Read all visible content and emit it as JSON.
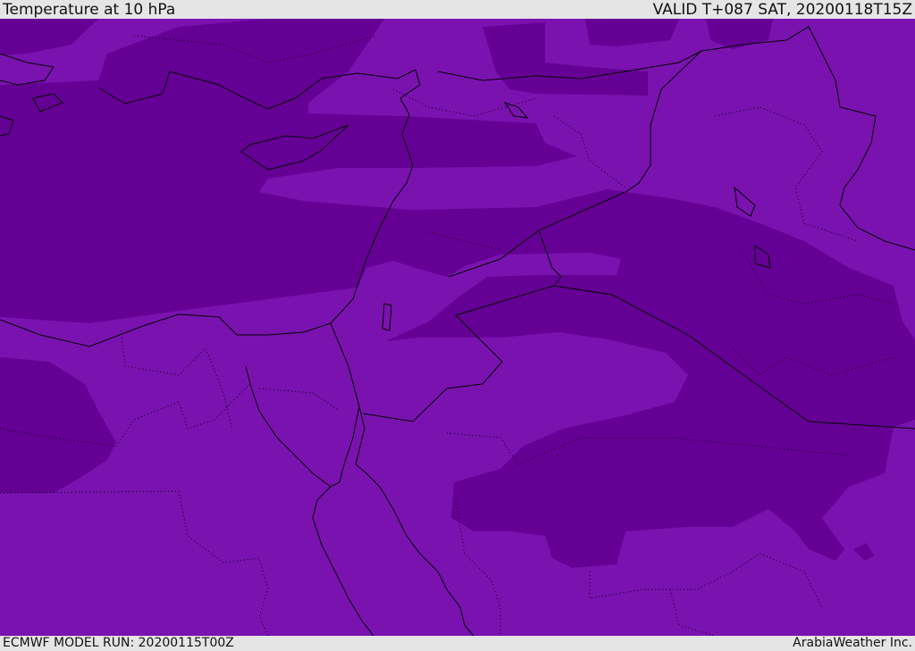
{
  "header": {
    "title": "Temperature at 10 hPa",
    "valid": "VALID T+087 SAT, 20200118T15Z"
  },
  "footer": {
    "model_run": "ECMWF MODEL RUN: 20200115T00Z",
    "credit": "ArabiaWeather Inc."
  },
  "colors": {
    "light_band": "#7a12b0",
    "dark_band": "#650095",
    "coastline": "#000000",
    "background": "#e5e5e5"
  }
}
